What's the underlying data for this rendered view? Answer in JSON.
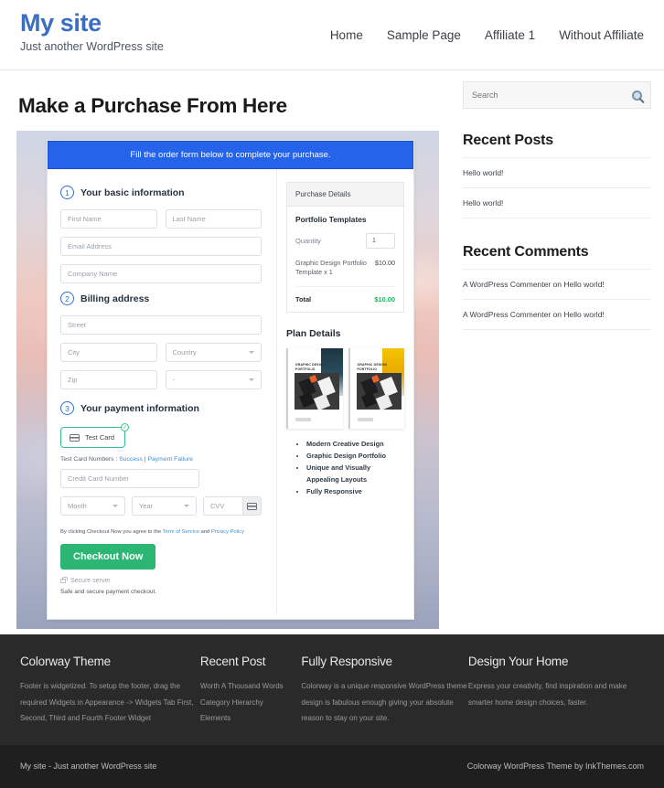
{
  "header": {
    "site_title": "My site",
    "tagline": "Just another WordPress site",
    "nav": [
      {
        "label": "Home"
      },
      {
        "label": "Sample Page"
      },
      {
        "label": "Affiliate 1"
      },
      {
        "label": "Without Affiliate"
      }
    ]
  },
  "main": {
    "page_title": "Make a Purchase From Here",
    "order_banner": "Fill the order form below to complete your purchase.",
    "steps": {
      "one_num": "1",
      "one_title": "Your basic information",
      "two_num": "2",
      "two_title": "Billing address",
      "three_num": "3",
      "three_title": "Your payment information"
    },
    "fields": {
      "first_name": "First Name",
      "last_name": "Last Name",
      "email": "Email Address",
      "company": "Company Name",
      "street": "Street",
      "city": "City",
      "country": "Country",
      "zip": "Zip",
      "state": "-",
      "credit_card": "Credit Card Number",
      "month": "Month",
      "year": "Year",
      "cvv": "CVV"
    },
    "payment": {
      "test_card_label": "Test Card",
      "check_mark": "✓",
      "test_numbers_prefix": "Test Card Numbers : ",
      "test_success": "Success",
      "test_separator": " | ",
      "test_failure": "Payment Failure",
      "agree_prefix": "By clicking Checkout Now you agree to the ",
      "terms_link": "Term of Service",
      "agree_and": " and ",
      "privacy_link": "Privacy Policy",
      "checkout_button": "Checkout Now",
      "secure_server": "Secure server",
      "safe_note": "Safe and secure payment checkout."
    },
    "summary": {
      "heading": "Purchase Details",
      "product_name": "Portfolio Templates",
      "quantity_label": "Quantity",
      "quantity_value": "1",
      "line_item_name": "Graphic Design Portfolio Template x 1",
      "line_item_price": "$10.00",
      "total_label": "Total",
      "total_value": "$10.00"
    },
    "plan": {
      "title": "Plan Details",
      "thumb_caption": "GRAPHIC DESIGN PORTFOLIO",
      "features": [
        "Modern Creative Design",
        "Graphic Design Portfolio",
        "Unique and Visually Appealing Layouts",
        "Fully Responsive"
      ]
    }
  },
  "sidebar": {
    "search_placeholder": "Search",
    "recent_posts_title": "Recent Posts",
    "recent_posts": [
      {
        "label": "Hello world!"
      },
      {
        "label": "Hello world!"
      }
    ],
    "recent_comments_title": "Recent Comments",
    "recent_comments": [
      {
        "label": "A WordPress Commenter on Hello world!"
      },
      {
        "label": "A WordPress Commenter on Hello world!"
      }
    ]
  },
  "footer": {
    "columns": [
      {
        "title": "Colorway Theme",
        "text": "Footer is widgetized. To setup the footer, drag the required Widgets in Appearance -> Widgets Tab First, Second, Third and Fourth Footer Widget"
      },
      {
        "title": "Recent Post",
        "items": [
          {
            "label": "Worth A Thousand Words"
          },
          {
            "label": "Category Hierarchy"
          },
          {
            "label": "Elements"
          }
        ]
      },
      {
        "title": "Fully Responsive",
        "text": "Colorway is a unique responsive WordPress theme design is fabulous enough giving your absolute reason to stay on your site."
      },
      {
        "title": "Design Your Home",
        "text": "Express your creativity, find inspiration and make smarter home design choices, faster."
      }
    ],
    "bar_left": "My site - Just another WordPress site",
    "bar_right": "Colorway WordPress Theme by InkThemes.com"
  },
  "colors": {
    "brand_blue": "#3c6ec0",
    "banner_blue": "#2563eb",
    "checkout_green": "#2bb673",
    "total_green": "#19b35c"
  }
}
